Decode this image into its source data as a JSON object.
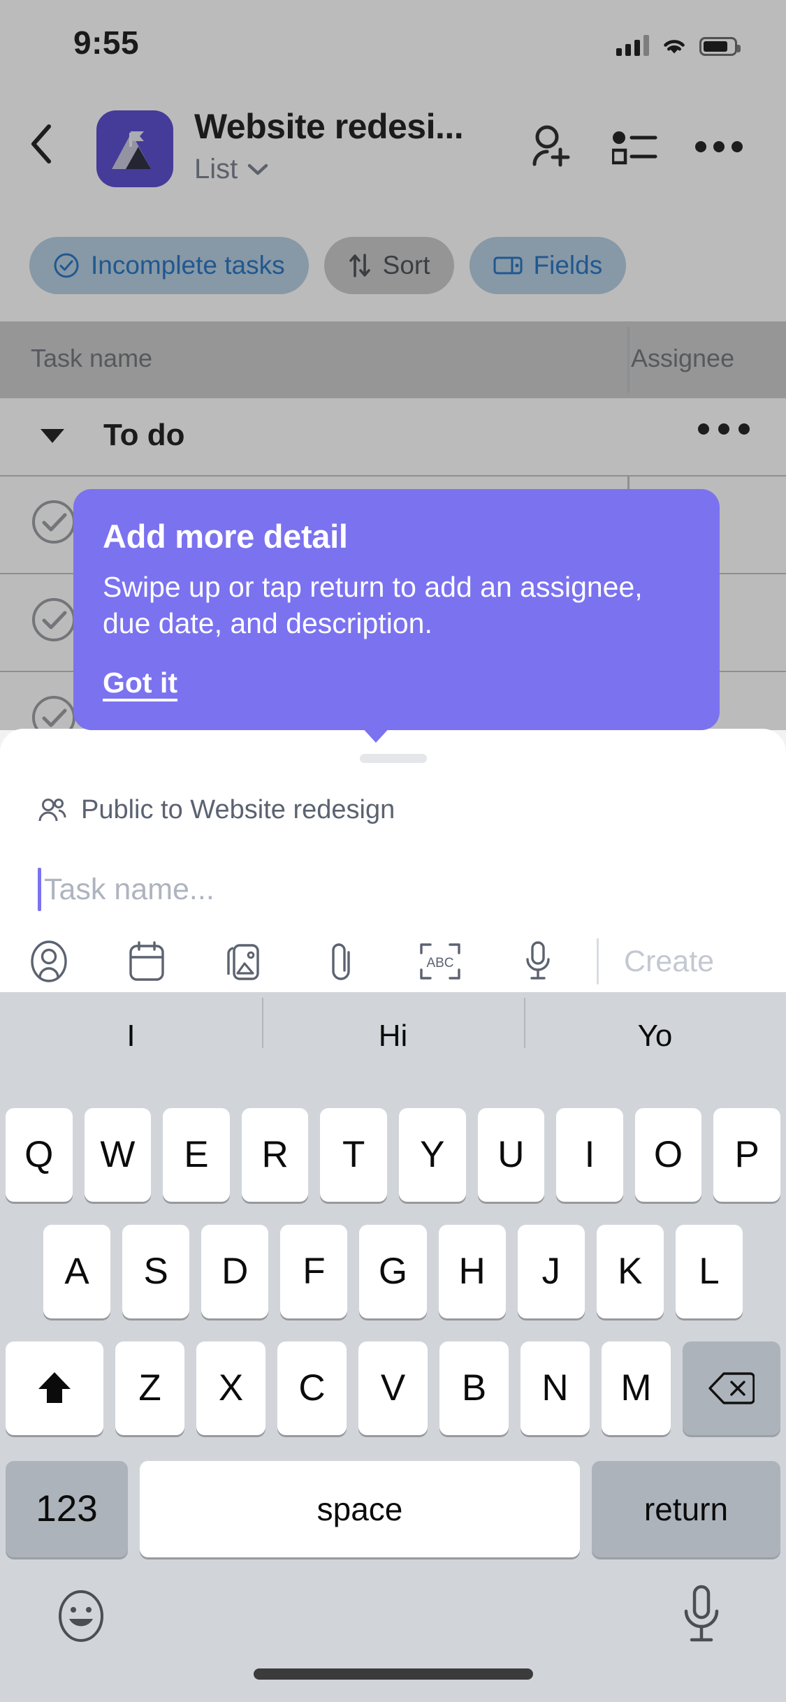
{
  "status_bar": {
    "time": "9:55",
    "cellular_icon": "signal-bars-icon",
    "wifi_icon": "wifi-icon",
    "battery_icon": "battery-icon"
  },
  "nav": {
    "back_icon": "back-chevron-icon",
    "project_icon": "project-mountain-icon",
    "title": "Website redesi...",
    "view_label": "List",
    "view_caret_icon": "chevron-down-icon",
    "add_member_icon": "add-person-icon",
    "list_view_icon": "list-view-icon",
    "overflow_icon": "more-horizontal-icon"
  },
  "filters": {
    "chips": [
      {
        "label": "Incomplete tasks",
        "icon": "check-circle-icon",
        "state": "active"
      },
      {
        "label": "Sort",
        "icon": "sort-arrows-icon",
        "state": "inactive"
      },
      {
        "label": "Fields",
        "icon": "fields-columns-icon",
        "state": "active"
      }
    ]
  },
  "table": {
    "columns": [
      "Task name",
      "Assignee"
    ],
    "section": {
      "title": "To do",
      "caret_icon": "caret-down-icon",
      "menu_icon": "more-horizontal-icon"
    },
    "rows": [
      {
        "checkbox_icon": "check-circle-icon"
      },
      {
        "checkbox_icon": "check-circle-icon"
      },
      {
        "checkbox_icon": "check-circle-icon"
      }
    ]
  },
  "coachmark": {
    "title": "Add more detail",
    "body": "Swipe up or tap return to add an assignee, due date, and description.",
    "cta": "Got it",
    "color": "#7b72f0"
  },
  "composer": {
    "privacy_icon": "people-icon",
    "privacy_label": "Public to Website redesign",
    "task_name_value": "",
    "task_name_placeholder": "Task name...",
    "toolbar_icons": [
      "assignee-icon",
      "due-date-icon",
      "photo-icon",
      "attachment-icon",
      "scan-text-icon",
      "voice-icon"
    ],
    "create_label": "Create"
  },
  "keyboard": {
    "suggestions": [
      "I",
      "Hi",
      "Yo"
    ],
    "row1": [
      "Q",
      "W",
      "E",
      "R",
      "T",
      "Y",
      "U",
      "I",
      "O",
      "P"
    ],
    "row2": [
      "A",
      "S",
      "D",
      "F",
      "G",
      "H",
      "J",
      "K",
      "L"
    ],
    "row3_letters": [
      "Z",
      "X",
      "C",
      "V",
      "B",
      "N",
      "M"
    ],
    "shift_icon": "shift-up-arrow-icon",
    "backspace_icon": "backspace-icon",
    "numbers_label": "123",
    "space_label": "space",
    "return_label": "return",
    "emoji_icon": "emoji-smiley-icon",
    "dictation_icon": "microphone-icon"
  }
}
